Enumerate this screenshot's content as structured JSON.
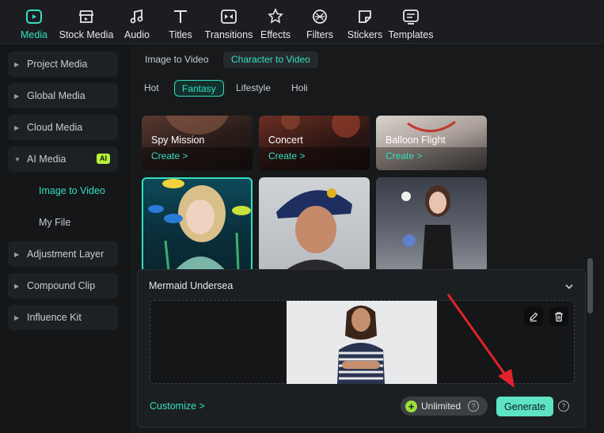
{
  "toolbar": {
    "items": [
      {
        "label": "Media",
        "icon": "media-icon",
        "active": true
      },
      {
        "label": "Stock Media",
        "icon": "stock-media-icon"
      },
      {
        "label": "Audio",
        "icon": "music-note-icon"
      },
      {
        "label": "Titles",
        "icon": "titles-icon"
      },
      {
        "label": "Transitions",
        "icon": "transitions-icon"
      },
      {
        "label": "Effects",
        "icon": "effects-icon"
      },
      {
        "label": "Filters",
        "icon": "filters-icon"
      },
      {
        "label": "Stickers",
        "icon": "stickers-icon"
      },
      {
        "label": "Templates",
        "icon": "templates-icon"
      }
    ]
  },
  "sidebar": {
    "items": [
      {
        "label": "Project Media"
      },
      {
        "label": "Global Media"
      },
      {
        "label": "Cloud Media"
      },
      {
        "label": "AI Media",
        "badge": "AI",
        "expanded": true
      },
      {
        "label": "Adjustment Layer"
      },
      {
        "label": "Compound Clip"
      },
      {
        "label": "Influence Kit"
      }
    ],
    "sub_items": [
      {
        "label": "Image to Video",
        "active": true
      },
      {
        "label": "My File"
      }
    ]
  },
  "main": {
    "mode_tabs": [
      "Image to Video",
      "Character to Video"
    ],
    "active_mode": "Character to Video",
    "category_tabs": [
      "Hot",
      "Fantasy",
      "Lifestyle",
      "Holi"
    ],
    "active_category": "Fantasy",
    "cards_row1": [
      {
        "title": "Spy Mission",
        "cta": "Create >"
      },
      {
        "title": "Concert",
        "cta": "Create >"
      },
      {
        "title": "Balloon Flight",
        "cta": "Create >"
      }
    ],
    "cards_row2": [
      {
        "name": "mermaid-template",
        "selected": true
      },
      {
        "name": "firefighter-template"
      },
      {
        "name": "fashion-template"
      }
    ]
  },
  "panel": {
    "title": "Mermaid Undersea",
    "customize": "Customize >",
    "unlimited": "Unlimited",
    "generate": "Generate"
  },
  "colors": {
    "accent": "#33e0c0",
    "generate_bg": "#5ee3c4",
    "arrow": "#e0222a",
    "ai_badge": "#b6f23a"
  }
}
